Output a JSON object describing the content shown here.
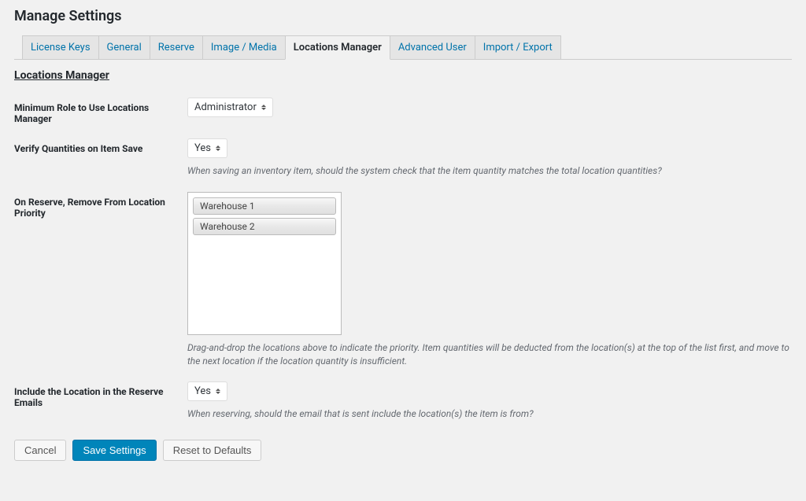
{
  "page_title": "Manage Settings",
  "tabs": {
    "license_keys": "License Keys",
    "general": "General",
    "reserve": "Reserve",
    "image_media": "Image / Media",
    "locations_manager": "Locations Manager",
    "advanced_user": "Advanced User",
    "import_export": "Import / Export"
  },
  "section_heading": "Locations Manager",
  "fields": {
    "min_role": {
      "label": "Minimum Role to Use Locations Manager",
      "value": "Administrator"
    },
    "verify_quantities": {
      "label": "Verify Quantities on Item Save",
      "value": "Yes",
      "help": "When saving an inventory item, should the system check that the item quantity matches the total location quantities?"
    },
    "location_priority": {
      "label": "On Reserve, Remove From Location Priority",
      "items": [
        "Warehouse 1",
        "Warehouse 2"
      ],
      "help": "Drag-and-drop the locations above to indicate the priority. Item quantities will be deducted from the location(s) at the top of the list first, and move to the next location if the location quantity is insufficient."
    },
    "include_location_emails": {
      "label": "Include the Location in the Reserve Emails",
      "value": "Yes",
      "help": "When reserving, should the email that is sent include the location(s) the item is from?"
    }
  },
  "buttons": {
    "cancel": "Cancel",
    "save": "Save Settings",
    "reset": "Reset to Defaults"
  }
}
